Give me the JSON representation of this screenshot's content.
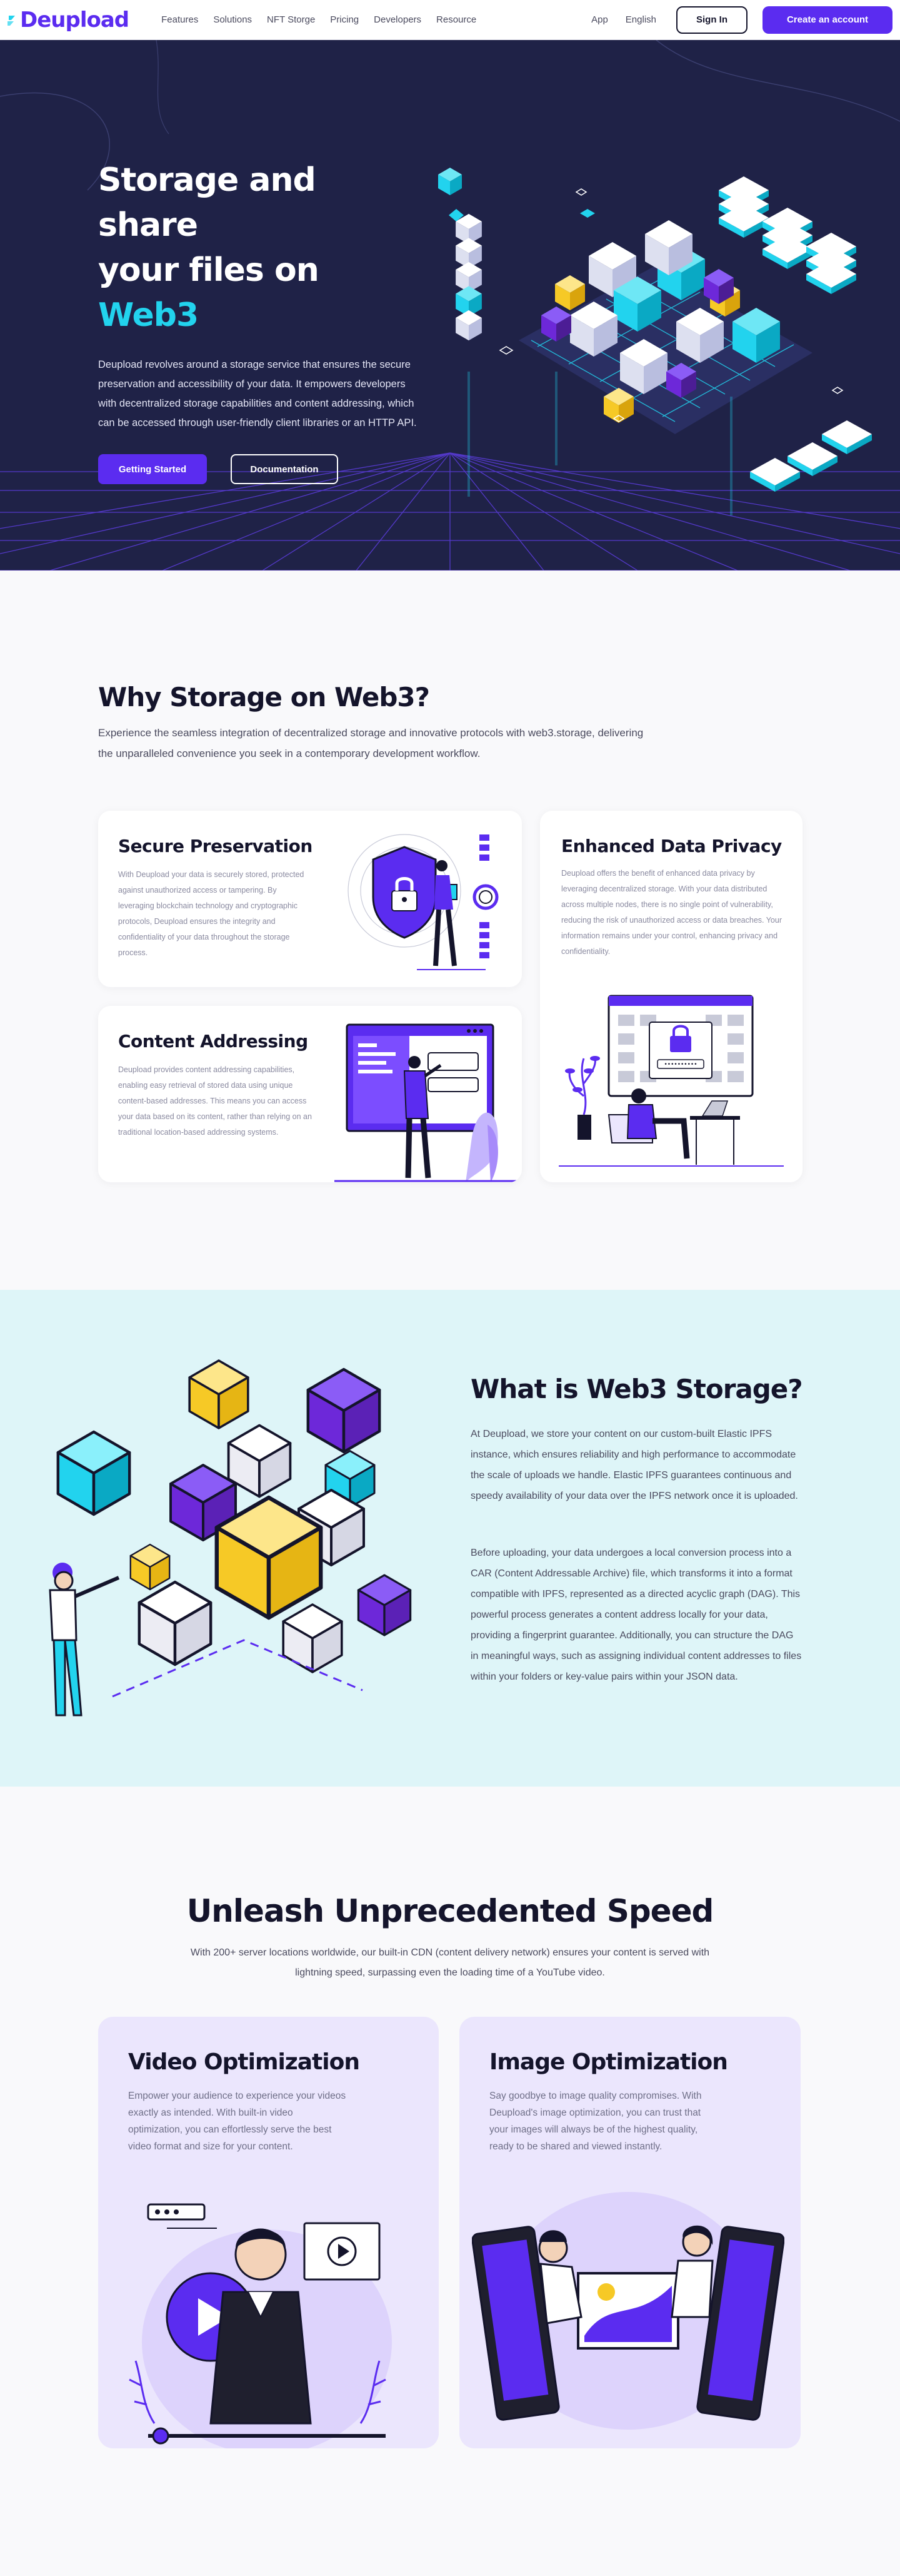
{
  "nav": {
    "logo": "Deupload",
    "links": [
      "Features",
      "Solutions",
      "NFT Storge",
      "Pricing",
      "Developers",
      "Resource"
    ],
    "app": "App",
    "language": "English",
    "signin": "Sign In",
    "create": "Create an account"
  },
  "hero": {
    "title_line1": "Storage and share",
    "title_line2_prefix": "your files on ",
    "title_accent": "Web3",
    "description": "Deupload revolves around a storage service that ensures the secure preservation and accessibility of your data. It empowers developers with decentralized storage capabilities and content addressing, which can be accessed through user-friendly client libraries or an HTTP API.",
    "primary_button": "Getting Started",
    "secondary_button": "Documentation"
  },
  "why": {
    "title": "Why Storage on Web3?",
    "subtitle": "Experience the seamless integration of decentralized storage and innovative protocols with web3.storage, delivering the unparalleled convenience you seek in a contemporary development workflow.",
    "cards": [
      {
        "title": "Secure Preservation",
        "text": "With Deupload your data is securely stored, protected against unauthorized access or tampering. By leveraging blockchain technology and cryptographic protocols, Deupload ensures the integrity and confidentiality of your data throughout the storage process."
      },
      {
        "title": "Enhanced Data Privacy",
        "text": "Deupload offers the benefit of enhanced data privacy by leveraging decentralized storage. With your data distributed across multiple nodes, there is no single point of vulnerability, reducing the risk of unauthorized access or data breaches. Your information remains under your control, enhancing privacy and confidentiality."
      },
      {
        "title": "Content Addressing",
        "text": "Deupload provides content addressing capabilities, enabling easy retrieval of stored data using unique content-based addresses. This means you can access your data based on its content, rather than relying on an traditional location-based addressing systems."
      }
    ],
    "login_password": "••••••••••"
  },
  "what": {
    "title": "What is Web3 Storage?",
    "p1": "At Deupload, we store your content on our custom-built Elastic IPFS instance, which ensures reliability and high performance to accommodate the scale of uploads we handle. Elastic IPFS guarantees continuous and speedy availability of your data over the IPFS network once it is uploaded.",
    "p2": "Before uploading, your data undergoes a local conversion process into a CAR (Content Addressable Archive) file, which transforms it into a format compatible with IPFS, represented as a directed acyclic graph (DAG). This powerful process generates a content address locally for your data, providing a fingerprint guarantee. Additionally, you can structure the DAG in meaningful ways, such as assigning individual content addresses to files within your folders or key-value pairs within your JSON data."
  },
  "speed": {
    "title": "Unleash Unprecedented Speed",
    "subtitle": "With 200+ server locations worldwide, our built-in CDN (content delivery network) ensures your content is served with lightning speed, surpassing even the loading time of a YouTube video.",
    "cards": [
      {
        "title": "Video Optimization",
        "text": "Empower your audience to experience your videos exactly as intended. With built-in video optimization, you can effortlessly serve the best video format and size for your content."
      },
      {
        "title": "Image Optimization",
        "text": "Say goodbye to image quality compromises. With Deupload's image optimization, you can trust that your images will always be of the highest quality, ready to be shared and viewed instantly."
      }
    ]
  },
  "colors": {
    "brand": "#5b2cf0",
    "hero_bg": "#1f2247",
    "accent": "#22d3ee",
    "what_bg": "#def5f8",
    "card_lavender": "#ebe6fd",
    "yellow": "#f6c926"
  }
}
